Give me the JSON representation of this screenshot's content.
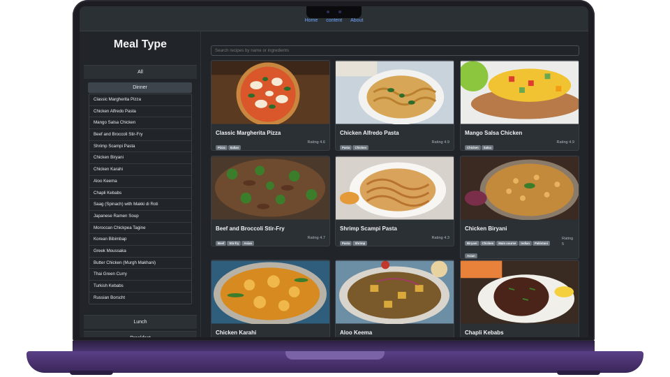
{
  "nav": {
    "links": [
      "Home",
      "content",
      "About"
    ]
  },
  "sidebar": {
    "title": "Meal Type",
    "categories": {
      "all": "All",
      "dinner": "Dinner",
      "lunch": "Lunch",
      "breakfast": "Breakfast"
    },
    "recipes": [
      "Classic Margherita Pizza",
      "Chicken Alfredo Pasta",
      "Mango Salsa Chicken",
      "Beef and Broccoli Stir-Fry",
      "Shrimp Scampi Pasta",
      "Chicken Biryani",
      "Chicken Karahi",
      "Aloo Keema",
      "Chapli Kebabs",
      "Saag (Spinach) with Makki di Roti",
      "Japanese Ramen Soup",
      "Moroccan Chickpea Tagine",
      "Korean Bibimbap",
      "Greek Moussaka",
      "Butter Chicken (Murgh Makhani)",
      "Thai Green Curry",
      "Turkish Kebabs",
      "Russian Borscht"
    ]
  },
  "search": {
    "placeholder": "Search recipes by name or ingredients"
  },
  "cards": [
    {
      "title": "Classic Margherita Pizza",
      "tags": [
        "Pizza",
        "Italian"
      ],
      "rating": "Rating 4.6",
      "image_icon": "pizza-photo"
    },
    {
      "title": "Chicken Alfredo Pasta",
      "tags": [
        "Pasta",
        "Chicken"
      ],
      "rating": "Rating 4.9",
      "image_icon": "pasta-photo"
    },
    {
      "title": "Mango Salsa Chicken",
      "tags": [
        "Chicken",
        "Salsa"
      ],
      "rating": "Rating 4.9",
      "image_icon": "mango-chicken-photo"
    },
    {
      "title": "Beef and Broccoli Stir-Fry",
      "tags": [
        "Beef",
        "Stir-fry",
        "Asian"
      ],
      "rating": "Rating 4.7",
      "image_icon": "beef-broccoli-photo"
    },
    {
      "title": "Shrimp Scampi Pasta",
      "tags": [
        "Pasta",
        "Shrimp"
      ],
      "rating": "Rating 4.3",
      "image_icon": "shrimp-pasta-photo"
    },
    {
      "title": "Chicken Biryani",
      "tags": [
        "Biryani",
        "Chicken",
        "Main course",
        "Indian",
        "Pakistani",
        "Asian"
      ],
      "rating_lines": [
        "Rating",
        "5"
      ],
      "image_icon": "biryani-photo"
    },
    {
      "title": "Chicken Karahi",
      "image_icon": "karahi-photo"
    },
    {
      "title": "Aloo Keema",
      "image_icon": "aloo-keema-photo"
    },
    {
      "title": "Chapli Kebabs",
      "image_icon": "kebab-photo"
    }
  ],
  "colors": {
    "background": "#212529",
    "nav": "#2b3035",
    "link": "#6ea8fe",
    "tag": "#6c757d",
    "laptop_base": "#4a3470"
  }
}
